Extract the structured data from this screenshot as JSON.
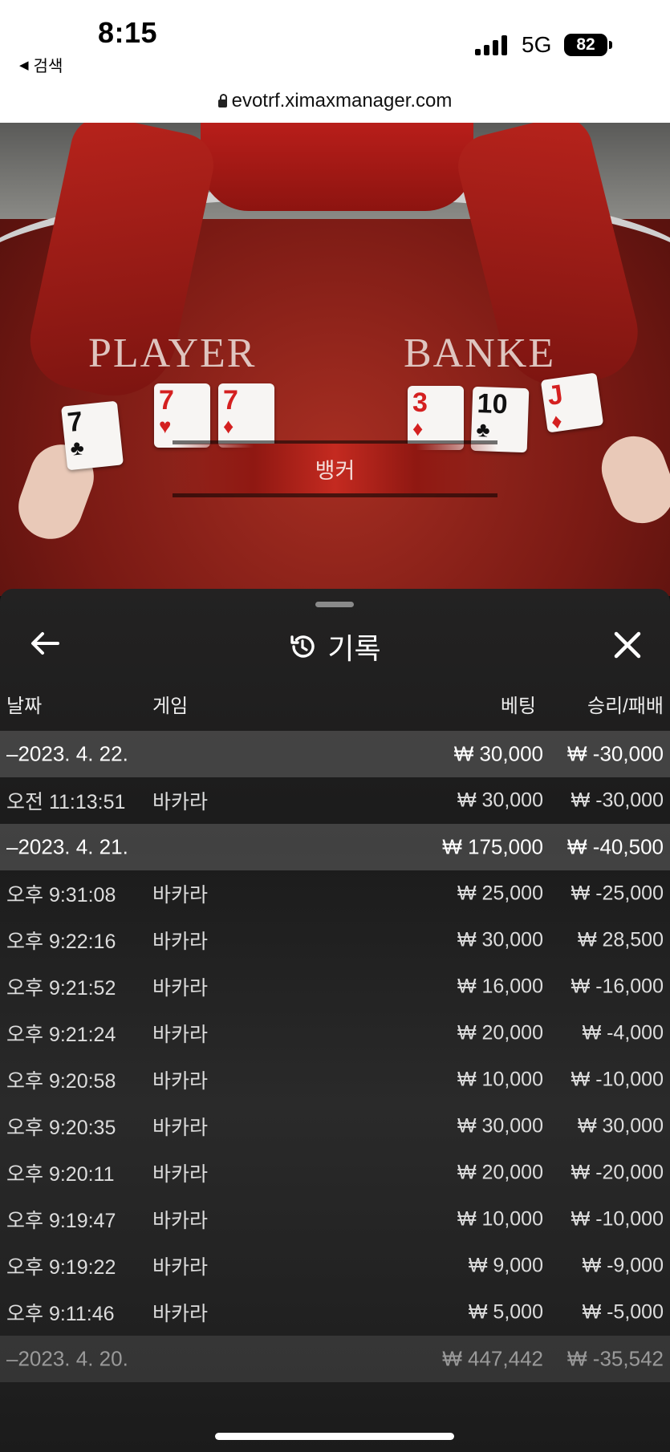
{
  "status": {
    "time": "8:15",
    "back_label": "검색",
    "network": "5G",
    "battery": "82"
  },
  "browser": {
    "url": "evotrf.ximaxmanager.com"
  },
  "game": {
    "player_label": "PLAYER",
    "banker_label": "BANKE",
    "result": "뱅커",
    "player_cards": [
      {
        "rank": "7",
        "suit": "♣"
      },
      {
        "rank": "7",
        "suit": "♥"
      },
      {
        "rank": "7",
        "suit": "♦"
      }
    ],
    "banker_cards": [
      {
        "rank": "3",
        "suit": "♦"
      },
      {
        "rank": "10",
        "suit": "♣"
      },
      {
        "rank": "J",
        "suit": "♦"
      }
    ]
  },
  "panel": {
    "title": "기록",
    "columns": {
      "date": "날짜",
      "game": "게임",
      "bet": "베팅",
      "winloss": "승리/패배"
    },
    "rows": [
      {
        "type": "group",
        "date": "–2023. 4. 22.",
        "game": "",
        "bet": "₩ 30,000",
        "winloss": "₩ -30,000"
      },
      {
        "type": "item",
        "date": "오전 11:13:51",
        "game": "바카라",
        "bet": "₩ 30,000",
        "winloss": "₩ -30,000"
      },
      {
        "type": "group",
        "date": "–2023. 4. 21.",
        "game": "",
        "bet": "₩ 175,000",
        "winloss": "₩ -40,500"
      },
      {
        "type": "item",
        "date": "오후 9:31:08",
        "game": "바카라",
        "bet": "₩ 25,000",
        "winloss": "₩ -25,000"
      },
      {
        "type": "item",
        "date": "오후 9:22:16",
        "game": "바카라",
        "bet": "₩ 30,000",
        "winloss": "₩ 28,500"
      },
      {
        "type": "item",
        "date": "오후 9:21:52",
        "game": "바카라",
        "bet": "₩ 16,000",
        "winloss": "₩ -16,000"
      },
      {
        "type": "item",
        "date": "오후 9:21:24",
        "game": "바카라",
        "bet": "₩ 20,000",
        "winloss": "₩ -4,000"
      },
      {
        "type": "item",
        "date": "오후 9:20:58",
        "game": "바카라",
        "bet": "₩ 10,000",
        "winloss": "₩ -10,000"
      },
      {
        "type": "item",
        "date": "오후 9:20:35",
        "game": "바카라",
        "bet": "₩ 30,000",
        "winloss": "₩ 30,000"
      },
      {
        "type": "item",
        "date": "오후 9:20:11",
        "game": "바카라",
        "bet": "₩ 20,000",
        "winloss": "₩ -20,000"
      },
      {
        "type": "item",
        "date": "오후 9:19:47",
        "game": "바카라",
        "bet": "₩ 10,000",
        "winloss": "₩ -10,000"
      },
      {
        "type": "item",
        "date": "오후 9:19:22",
        "game": "바카라",
        "bet": "₩ 9,000",
        "winloss": "₩ -9,000"
      },
      {
        "type": "item",
        "date": "오후 9:11:46",
        "game": "바카라",
        "bet": "₩ 5,000",
        "winloss": "₩ -5,000"
      },
      {
        "type": "group-dim",
        "date": "–2023. 4. 20.",
        "game": "",
        "bet": "₩ 447,442",
        "winloss": "₩ -35,542"
      }
    ]
  }
}
